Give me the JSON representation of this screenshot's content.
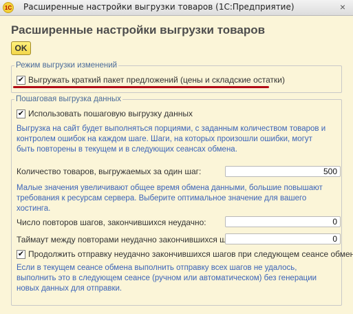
{
  "window": {
    "app_icon_text": "1С",
    "title": "Расширенные настройки выгрузки товаров  (1С:Предприятие)",
    "close_symbol": "×"
  },
  "heading": "Расширенные настройки выгрузки товаров",
  "ok_label": "OK",
  "mode_group": {
    "legend": "Режим выгрузки изменений",
    "checkbox_label": "Выгружать краткий пакет предложений (цены и складские остатки)",
    "checked": true
  },
  "step_group": {
    "legend": "Пошаговая выгрузка данных",
    "use_step_label": "Использовать пошаговую выгрузку данных",
    "use_step_checked": true,
    "note1": "Выгрузка на сайт будет выполняться порциями, с заданным количеством товаров и контролем ошибок на каждом шаге. Шаги, на которых произошли ошибки, могут быть повторены в текущем и в следующих сеансах обмена.",
    "items_per_step_label": "Количество товаров, выгружаемых за один шаг:",
    "items_per_step_value": "500",
    "note2": "Малые значения увеличивают общее время обмена данными, большие повышают требования к ресурсам сервера. Выберите оптимальное значение для вашего хостинга.",
    "retries_label": "Число повторов шагов, закончившихся неудачно:",
    "retries_value": "0",
    "timeout_label": "Таймаут между повторами неудачно закончившихся шагов:",
    "timeout_value": "0",
    "continue_label": "Продолжить отправку неудачно закончившихся шагов при следующем сеансе обмена",
    "continue_checked": true,
    "note3": "Если в текущем сеансе обмена выполнить отправку всех шагов не удалось, выполнить это в следующем сеансе (ручном или автоматическом) без генерации новых данных для отправки."
  },
  "check_symbol": "✔",
  "colors": {
    "background": "#fbf5d8",
    "note_text": "#3a63b8",
    "legend_text": "#4a6b9a",
    "ok_button": "#f2d64a",
    "annotation_underline": "#b10a15"
  },
  "icons": {
    "app": "1c-app-icon",
    "close": "close-icon",
    "check": "checkmark-icon"
  }
}
